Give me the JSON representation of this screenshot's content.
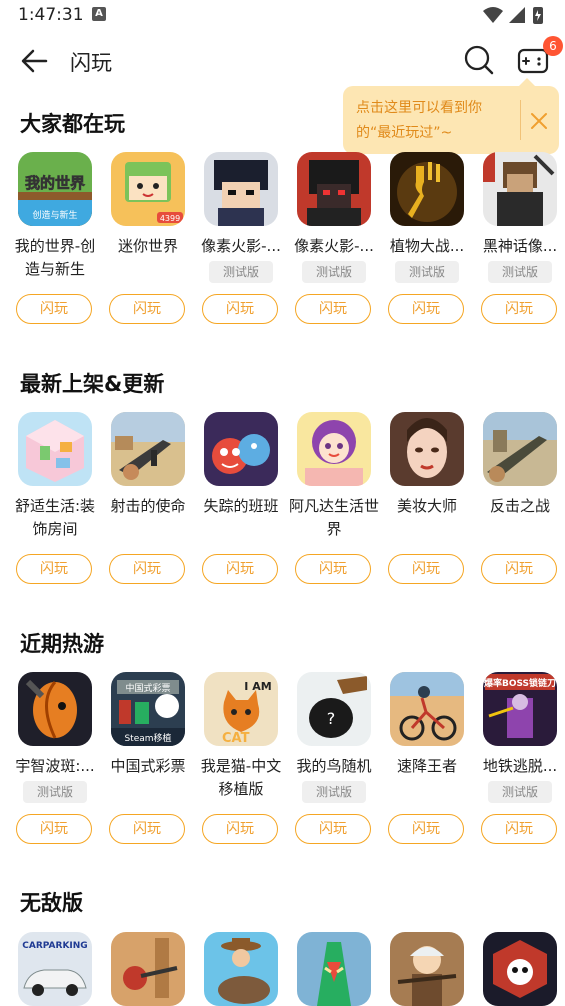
{
  "status_bar": {
    "time": "1:47:31",
    "notification_letter": "A"
  },
  "header": {
    "title": "闪玩",
    "notification_count": "6"
  },
  "tooltip": {
    "text": "点击这里可以看到你的“最近玩过”~"
  },
  "sections": [
    {
      "title": "大家都在玩",
      "games": [
        {
          "name": "我的世界-创造与新生",
          "tag": "",
          "icon": "minecraft-icon"
        },
        {
          "name": "迷你世界",
          "tag": "",
          "icon": "mini-world-icon"
        },
        {
          "name": "像素火影-...",
          "tag": "测试版",
          "icon": "pixel-naruto-icon"
        },
        {
          "name": "像素火影-...",
          "tag": "测试版",
          "icon": "pixel-naruto-red-icon"
        },
        {
          "name": "植物大战...",
          "tag": "测试版",
          "icon": "plants-fork-icon"
        },
        {
          "name": "黑神话像...",
          "tag": "测试版",
          "icon": "pixel-monkey-icon"
        }
      ]
    },
    {
      "title": "最新上架&更新",
      "games": [
        {
          "name": "舒适生活:装饰房间",
          "tag": "",
          "icon": "room-decor-icon"
        },
        {
          "name": "射击的使命",
          "tag": "",
          "icon": "rifle-desert-icon"
        },
        {
          "name": "失踪的班班",
          "tag": "",
          "icon": "banban-icon"
        },
        {
          "name": "阿凡达生活世界",
          "tag": "",
          "icon": "avatar-girl-icon"
        },
        {
          "name": "美妆大师",
          "tag": "",
          "icon": "makeup-icon"
        },
        {
          "name": "反击之战",
          "tag": "",
          "icon": "rifle-battle-icon"
        }
      ]
    },
    {
      "title": "近期热游",
      "games": [
        {
          "name": "宇智波斑:...",
          "tag": "测试版",
          "icon": "obito-mask-icon"
        },
        {
          "name": "中国式彩票",
          "tag": "",
          "icon": "lottery-steam-icon"
        },
        {
          "name": "我是猫-中文移植版",
          "tag": "",
          "icon": "i-am-cat-icon"
        },
        {
          "name": "我的鸟随机",
          "tag": "测试版",
          "icon": "bird-random-icon"
        },
        {
          "name": "速降王者",
          "tag": "",
          "icon": "downhill-bike-icon"
        },
        {
          "name": "地铁逃脱...",
          "tag": "测试版",
          "icon": "metro-escape-icon"
        }
      ]
    },
    {
      "title": "无敌版",
      "games": [
        {
          "name": "",
          "tag": "",
          "icon": "car-parking-icon"
        },
        {
          "name": "",
          "tag": "",
          "icon": "shooter-city-icon"
        },
        {
          "name": "",
          "tag": "",
          "icon": "cowboy-rodeo-icon"
        },
        {
          "name": "",
          "tag": "",
          "icon": "sand-worm-icon"
        },
        {
          "name": "",
          "tag": "",
          "icon": "old-man-icon"
        },
        {
          "name": "",
          "tag": "",
          "icon": "panda-cube-icon"
        }
      ]
    }
  ],
  "play_label": "闪玩",
  "colors": {
    "accent": "#f5a623",
    "tooltip_bg": "#fde6b3",
    "badge": "#ff5533"
  }
}
